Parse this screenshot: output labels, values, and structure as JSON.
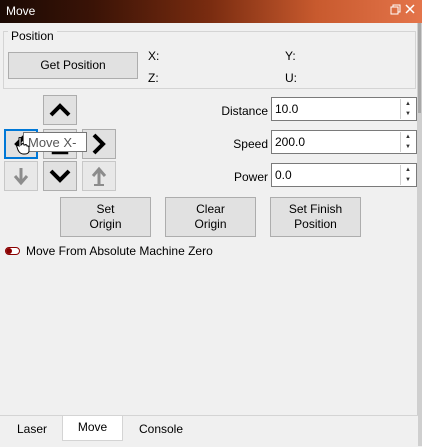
{
  "window": {
    "title": "Move",
    "restore_icon": "restore-window-icon",
    "close_icon": "close-icon"
  },
  "position": {
    "group_title": "Position",
    "get_position_label": "Get Position",
    "x_label": "X:",
    "y_label": "Y:",
    "z_label": "Z:",
    "u_label": "U:"
  },
  "jog": {
    "up_icon": "arrow-up-icon",
    "left_icon": "arrow-left-icon",
    "home_icon": "home-icon",
    "right_icon": "arrow-right-icon",
    "z_down_icon": "z-down-icon",
    "down_icon": "arrow-down-icon",
    "z_up_icon": "z-up-icon",
    "tooltip": "Move X-"
  },
  "fields": {
    "distance_label": "Distance",
    "distance_value": "10.0",
    "speed_label": "Speed",
    "speed_value": "200.0",
    "power_label": "Power",
    "power_value": "0.0"
  },
  "buttons": {
    "set_origin": "Set\nOrigin",
    "clear_origin": "Clear\nOrigin",
    "set_finish_position": "Set Finish\nPosition"
  },
  "absolute_zero": {
    "label": "Move From Absolute Machine Zero",
    "checked": false
  },
  "tabs": [
    "Laser",
    "Move",
    "Console"
  ],
  "active_tab": "Move",
  "colors": {
    "toggle": "#8a0000",
    "focus": "#0078d7"
  }
}
